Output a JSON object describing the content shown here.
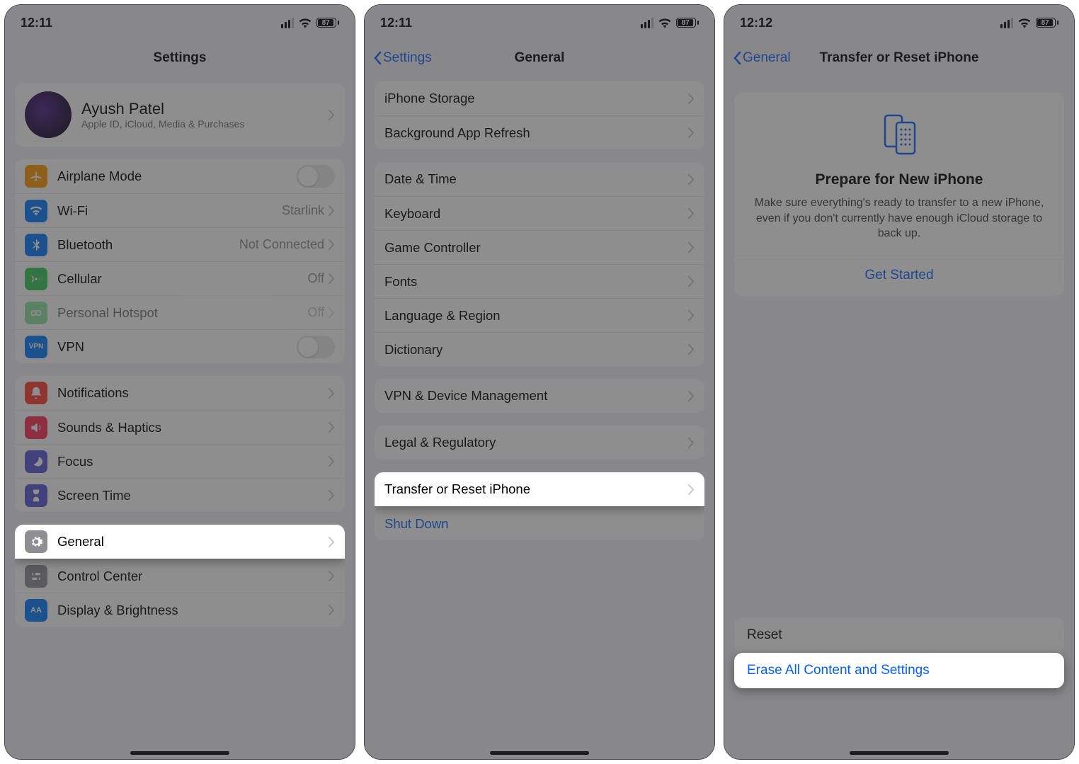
{
  "status": {
    "time1": "12:11",
    "time2": "12:11",
    "time3": "12:12",
    "battery": "87"
  },
  "screen1": {
    "title": "Settings",
    "profile": {
      "name": "Ayush Patel",
      "sub": "Apple ID, iCloud, Media & Purchases"
    },
    "g1": {
      "airplane": "Airplane Mode",
      "wifi": "Wi-Fi",
      "wifi_val": "Starlink",
      "bt": "Bluetooth",
      "bt_val": "Not Connected",
      "cell": "Cellular",
      "cell_val": "Off",
      "hotspot": "Personal Hotspot",
      "hotspot_val": "Off",
      "vpn": "VPN"
    },
    "g2": {
      "notif": "Notifications",
      "sounds": "Sounds & Haptics",
      "focus": "Focus",
      "screentime": "Screen Time"
    },
    "g3": {
      "general": "General",
      "control": "Control Center",
      "display": "Display & Brightness"
    }
  },
  "screen2": {
    "back": "Settings",
    "title": "General",
    "g1": {
      "storage": "iPhone Storage",
      "bg": "Background App Refresh"
    },
    "g2": {
      "date": "Date & Time",
      "kb": "Keyboard",
      "game": "Game Controller",
      "fonts": "Fonts",
      "lang": "Language & Region",
      "dict": "Dictionary"
    },
    "g3": {
      "vpn": "VPN & Device Management"
    },
    "g4": {
      "legal": "Legal & Regulatory"
    },
    "g5": {
      "transfer": "Transfer or Reset iPhone",
      "shut": "Shut Down"
    }
  },
  "screen3": {
    "back": "General",
    "title": "Transfer or Reset iPhone",
    "card": {
      "heading": "Prepare for New iPhone",
      "body": "Make sure everything's ready to transfer to a new iPhone, even if you don't currently have enough iCloud storage to back up.",
      "cta": "Get Started"
    },
    "reset": "Reset",
    "erase": "Erase All Content and Settings"
  }
}
